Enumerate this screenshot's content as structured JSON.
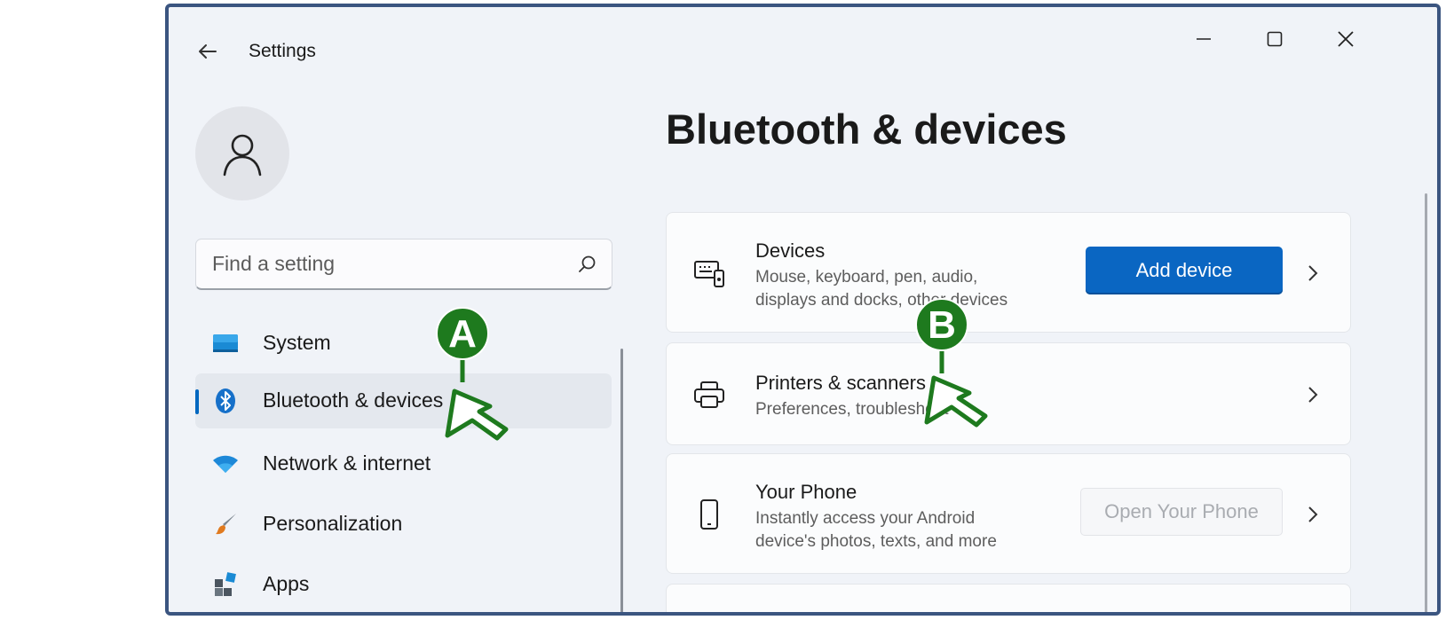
{
  "window": {
    "title": "Settings",
    "controls": [
      "minimize-icon",
      "maximize-icon",
      "close-icon"
    ]
  },
  "search": {
    "placeholder": "Find a setting"
  },
  "nav": {
    "items": [
      {
        "label": "System",
        "icon": "system-monitor-icon",
        "active": false
      },
      {
        "label": "Bluetooth & devices",
        "icon": "bluetooth-icon",
        "active": true
      },
      {
        "label": "Network & internet",
        "icon": "wifi-icon",
        "active": false
      },
      {
        "label": "Personalization",
        "icon": "paintbrush-icon",
        "active": false
      },
      {
        "label": "Apps",
        "icon": "apps-icon",
        "active": false
      }
    ]
  },
  "main": {
    "title": "Bluetooth & devices",
    "cards": [
      {
        "title": "Devices",
        "desc1": "Mouse, keyboard, pen, audio,",
        "desc2": "displays and docks, other devices",
        "button": "Add device",
        "icon": "devices-icon"
      },
      {
        "title": "Printers & scanners",
        "desc1": "Preferences, troubleshoot",
        "icon": "printer-icon"
      },
      {
        "title": "Your Phone",
        "desc1": "Instantly access your Android",
        "desc2": "device's photos, texts, and more",
        "button": "Open Your Phone",
        "icon": "phone-icon"
      }
    ]
  },
  "annotations": {
    "a": "A",
    "b": "B"
  },
  "colors": {
    "accent": "#0a66c2",
    "marker": "#1e7a1e",
    "window_border": "#3b5580"
  }
}
